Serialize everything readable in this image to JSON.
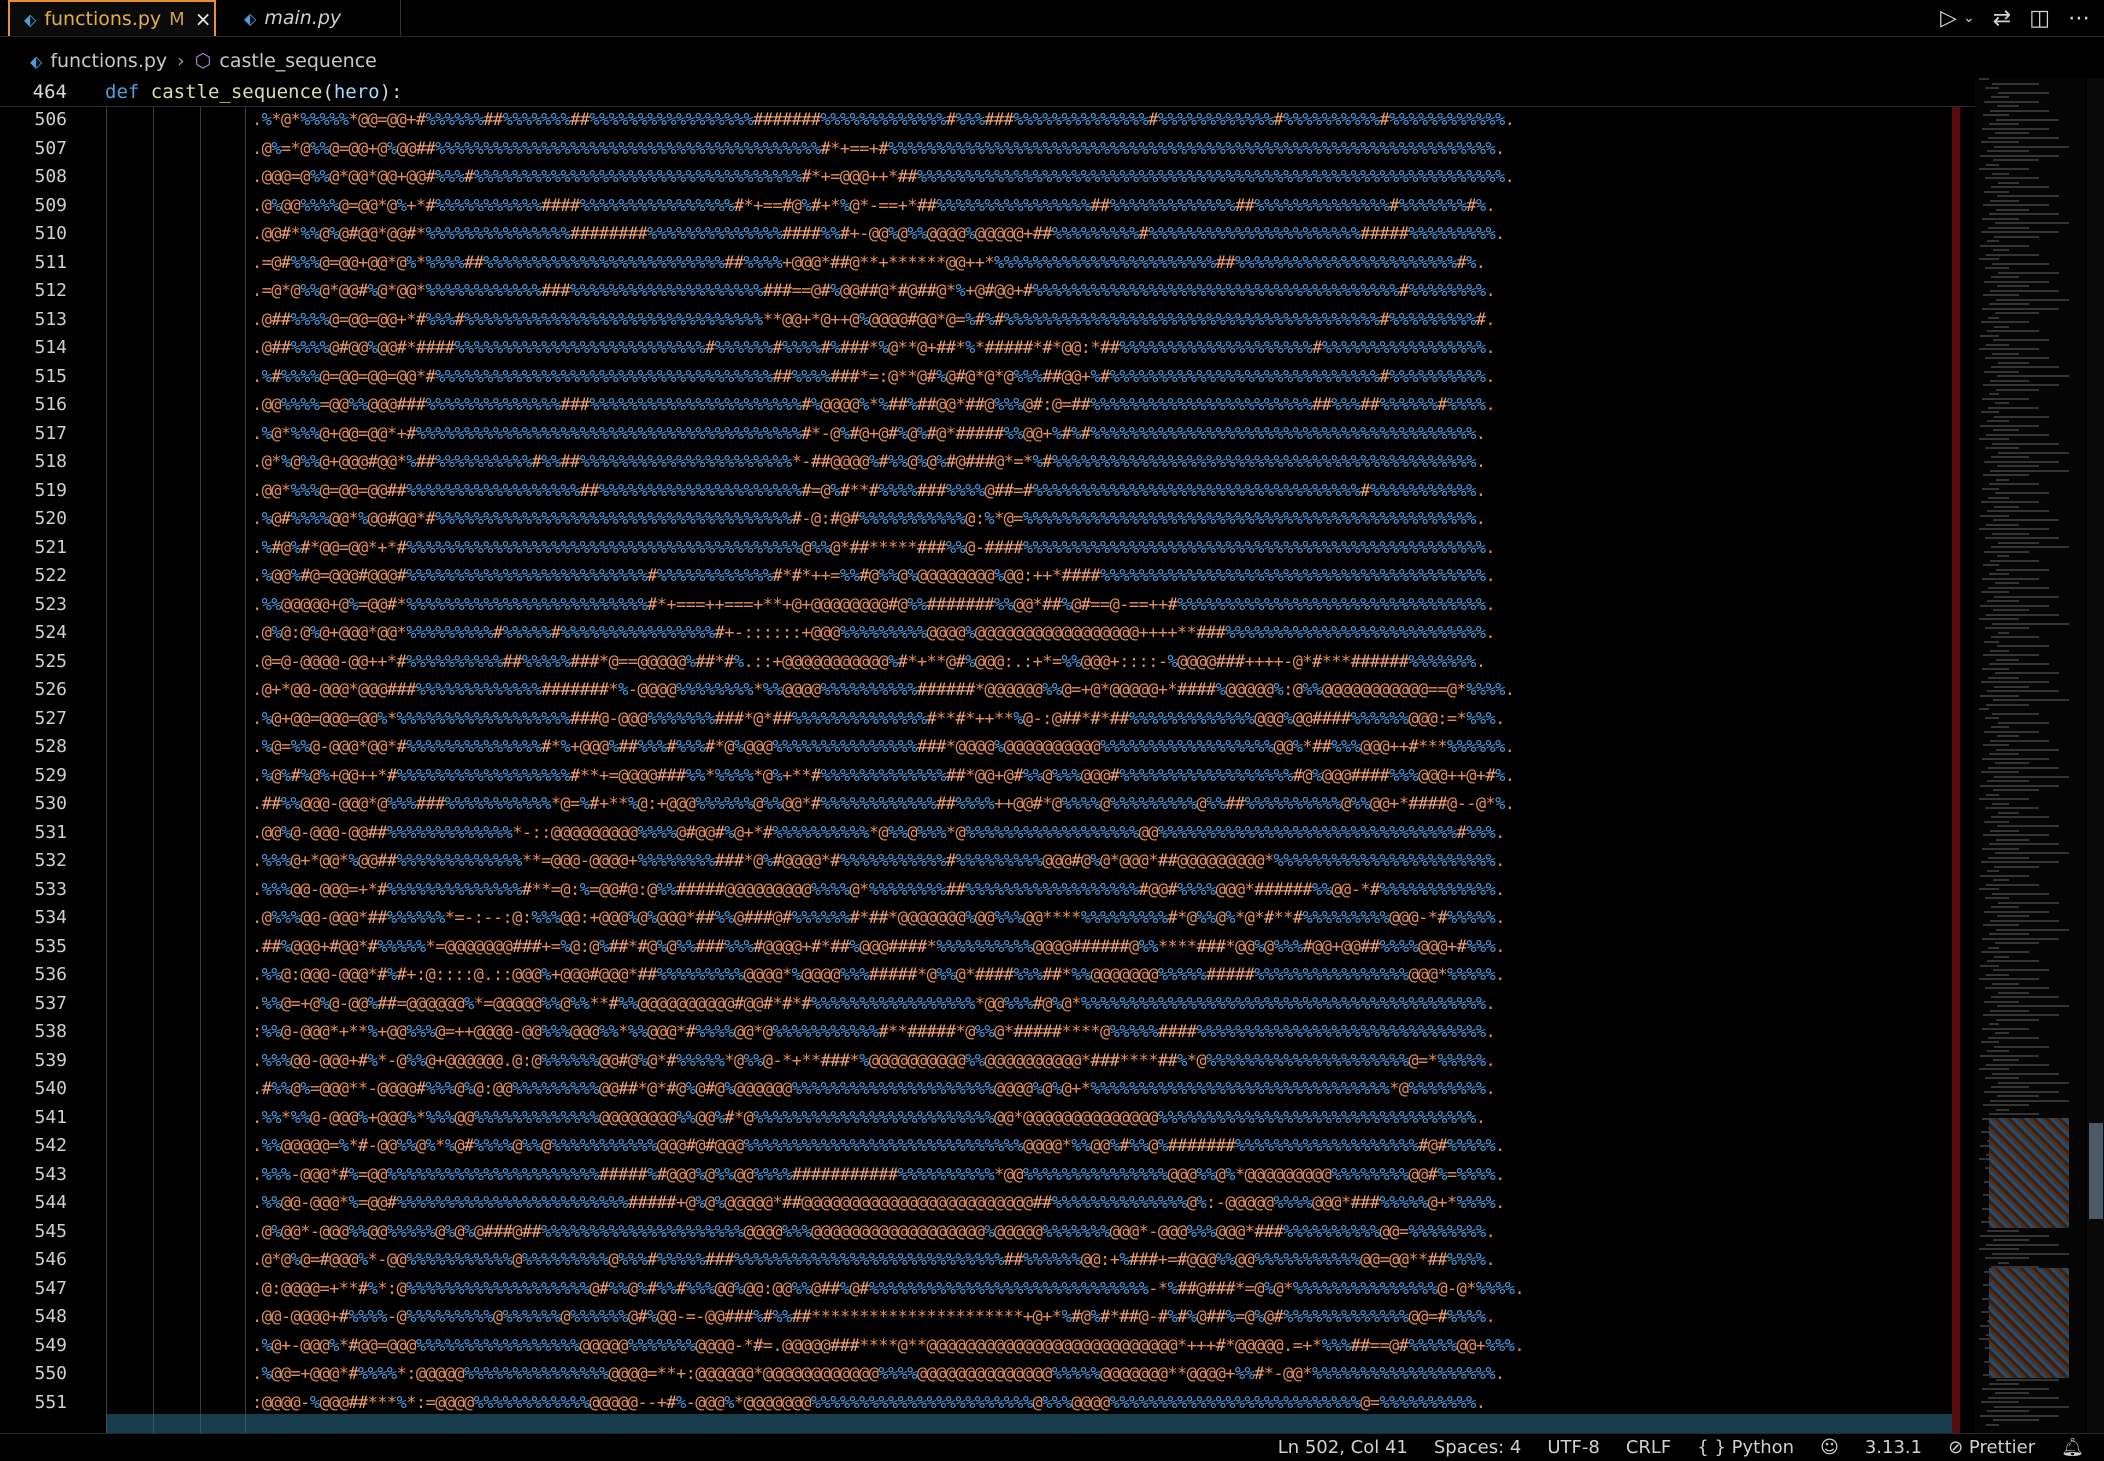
{
  "tabs": [
    {
      "label": "functions.py",
      "modified": "M",
      "close": "×"
    },
    {
      "label": "main.py"
    }
  ],
  "toolbar_icons": [
    "run-icon",
    "dropdown-icon",
    "compare-changes-icon",
    "split-editor-icon",
    "more-actions-icon"
  ],
  "breadcrumb": {
    "file": "functions.py",
    "symbol": "castle_sequence"
  },
  "sticky_line": {
    "number": "464",
    "keyword": "def",
    "function": "castle_sequence",
    "param": "hero",
    "open": "(",
    "close": "):"
  },
  "editor": {
    "line_numbers": [
      "506",
      "507",
      "508",
      "509",
      "510",
      "511",
      "512",
      "513",
      "514",
      "515",
      "516",
      "517",
      "518",
      "519",
      "520",
      "521",
      "522",
      "523",
      "524",
      "525",
      "526",
      "527",
      "528",
      "529",
      "530",
      "531",
      "532",
      "533",
      "534",
      "535",
      "536",
      "537",
      "538",
      "539",
      "540",
      "541",
      "542",
      "543",
      "544",
      "545",
      "546",
      "547",
      "548",
      "549",
      "550",
      "551"
    ],
    "content_note_hidden": "",
    "lines": [
      ".%*@*%%%%%*@@=@@+#%%%%%%##%%%%%%%##%%%%%%%%%%%%%%%%%#######%%%%%%%%%%%%%#%%%###%%%%%%%%%%%%%%#%%%%%%%%%%%%#%%%%%%%%%%#%%%%%%%%%%%%.",
      ".@%=*@%%@=@@+@%@@##%%%%%%%%%%%%%%%%%%%%%%%%%%%%%%%%%%%%%%%%#*+==+#%%%%%%%%%%%%%%%%%%%%%%%%%%%%%%%%%%%%%%%%%%%%%%%%%%%%%%%%%%%%%%%.",
      ".@@@=@%%@*@@*@@+@@#%%%#%%%%%%%%%%%%%%%%%%%%%%%%%%%%%%%%%%#*+=@@@++*##%%%%%%%%%%%%%%%%%%%%%%%%%%%%%%%%%%%%%%%%%%%%%%%%%%%%%%%%%%%%%.",
      ".@%@@%%%%@=@@*@%+*#%%%%%%%%%%%####%%%%%%%%%%%%%%%%#*+==#@%#+*%@*-==+*##%%%%%%%%%%%%%%%%##%%%%%%%%%%%%%##%%%%%%%%%%%%%%#%%%%%%%#%.",
      ".@@#*%%@%@#@@*@@#*%%%%%%%%%%%%%%%########%%%%%%%%%%%%%%####%%#+-@@%@%%@@@@%@@@@@+##%%%%%%%%%#%%%%%%%%%%%%%%%%%%%%%%#####%%%%%%%%%.",
      ".=@#%%%@=@@+@@*@%*%%%%##%%%%%%%%%%%%%%%%%%%%%%%%%##%%%%+@@@*##@**+******@@++*%%%%%%%%%%%%%%%%%%%%%%%##%%%%%%%%%%%%%%%%%%%%%%%#%.",
      ".=@*@%%@*@@#%@*@@*%%%%%%%%%%%%###%%%%%%%%%%%%%%%%%%%%###==@#%@@##@*#@##@*%+@#@@+#%%%%%%%%%%%%%%%%%%%%%%%%%%%%%%%%%%%%%%#%%%%%%%%.",
      ".@##%%%%@=@@=@@+*#%%%#%%%%%%%%%%%%%%%%%%%%%%%%%%%%%%%**@@+*@++@%@@@@#@@*@=%#%#%%%%%%%%%%%%%%%%%%%%%%%%%%%%%%%%%%%%%%%#%%%%%%%%%#.",
      ".@##%%%%@#@@%@@#*####%%%%%%%%%%%%%%%%%%%%%%%%%%#%%%%%%#%%%%#%###*%@**@+##*%*#####*#*@@:*##%%%%%%%%%%%%%%%%%%%%#%%%%%%%%%%%%%%%%%.",
      ".%#%%%%@=@@=@@=@@*#%%%%%%%%%%%%%%%%%%%%%%%%%%%%%%%%%%%##%%%%###*=:@**@#%@#@*@*@%%%##@@+%#%%%%%%%%%%%%%%%%%%%%%%%%%%%%#%%%%%%%%%%.",
      ".@@%%%%=@@%%@@@###%%%%%%%%%%%%%%###%%%%%%%%%%%%%%%%%%%%%%#%@@@@%*%##%##@@*##@%%%@#:@=##%%%%%%%%%%%%%%%%%%%%%%%##%%%##%%%%%%#%%%%.",
      ".%@*%%%@+@@=@@*+#%%%%%%%%%%%%%%%%%%%%%%%%%%%%%%%%%%%%%%%%#*-@%#@+@#%@%#@*#####%%@@+%#%#%%%%%%%%%%%%%%%%%%%%%%%%%%%%%%%%%%%%%%%%.",
      ".@*%@%%@+@@@#@@*%##%%%%%%%%%%#%%##%%%%%%%%%%%%%%%%%%%%%%*-##@@@@%#%%@%@%#@###@*=*%#%%%%%%%%%%%%%%%%%%%%%%%%%%%%%%%%%%%%%%%%%%%%.",
      ".@@*%%%@=@@=@@##%%%%%%%%%%%%%%%%%%##%%%%%%%%%%%%%%%%%%%%%#=@%#**#%%%%###%%%%@##=#%%%%%%%%%%%%%%%%%%%%%%%%%%%%%%%%%%#%%%%%%%%%%%.",
      ".%@#%%%%@@*%@@#@@*#%%%%%%%%%%%%%%%%%%%%%%%%%%%%%%%%%%%%%#-@:#@#%%%%%%%%%%%@:%*@=%%%%%%%%%%%%%%%%%%%%%%%%%%%%%%%%%%%%%%%%%%%%%%%.",
      ".%#@%#*@@=@@*+*#%%%%%%%%%%%%%%%%%%%%%%%%%%%%%%%%%%%%%%%%%@%%@*##*****###%%@-####%%%%%%%%%%%%%%%%%%%%%%%%%%%%%%%%%%%%%%%%%%%%%%%%.",
      ".%@@%#@=@@@#@@@#%%%%%%%%%%%%%%%%%%%%%%%%%#%%%%%%%%%%%%#*#*++=%%#@%%@%@@@@@@@@%@@:++*####%%%%%%%%%%%%%%%%%%%%%%%%%%%%%%%%%%%%%%%%.",
      ".%%@@@@@+@%=@@#*%%%%%%%%%%%%%%%%%%%%%%%%%#*+===++===+**+@+@@@@@@@@#@%%#######%%@@*##%@#==@-==++#%%%%%%%%%%%%%%%%%%%%%%%%%%%%%%%%.",
      ".@%@:@%@+@@@*@@*%%%%%%%%%#%%%%%#%%%%%%%%%%%%%%%%#+-::::::+@@@%%%%%%%%%@@@@%@@@@@@@@@@@@@@@@@++++**###%%%%%%%%%%%%%%%%%%%%%%%%%%%.",
      ".@=@-@@@@-@@++*#%%%%%%%%%%##%%%%%###*@==@@@@@%##*#%.::+@@@@@@@@@@@%#*+**@#%@@@:.:+*=%%@@@+::::-%@@@@###++++-@*#***######%%%%%%%.",
      ".@+*@@-@@@*@@@###%%%%%%%%%%%%%#######*%-@@@@%%%%%%%%*%%@@@@%%%%%%%%%%######*@@@@@@%%@=+@*@@@@@+*####%@@@@@%:@%%@@@@@@@@@@@==@*%%%%.",
      ".%@+@@=@@@=@@%*%%%%%%%%%%%%%%%%%%###@-@@@%%%%%%%###*@*##%%%%%%%%%%%%%%#**#*++**%@-:@##*#*##%%%%%%%%%%%%%@@@%@@####%%%%%%@@@:=*%%%.",
      ".%@=%%@-@@@*@@*#%%%%%%%%%%%%%%#*%+@@@%##%%%#%%%#*@%@@@%%%%%%%%%%%%%%%###*@@@@%@@@@@@@@@@%%%%%%%%%%%%%%%%%%@@%*##%%%@@@++#***%%%%%%.",
      ".%@%#%@%+@@++*#%%%%%%%%%%%%%%%%%%#**+=@@@@###%%*%%%%*@%+**#%%%%%%%%%%%%%##*@@+@#%%@%%%@@@#%%%%%%%%%%%%%%%%%%#@%@@@####%%%@@@++@+#%.",
      ".##%%@@@-@@@*@%%%###%%%%%%%%%%%*@=%#+**%@:+@@@%%%%%%@%%@@*#%%%%%%%%%%%%##%%%%++@@#*@%%%%@%%%%%%%%%@%%##%%%%%%%%%%@%%@@+*####@--@*%.",
      ".@@%@-@@@-@@##%%%%%%%%%%%%%*-::@@@@@@@@@%%%%@#@@#%@+*#%%%%%%%%%%*@%%@%%%*@%%%%%%%%%%%%%%%%%%@@%%%%%%%%%%%%%%%%%%%%%%%%%%%%%%%#%%%.",
      ".%%%@+*@@*%@@##%%%%%%%%%%%%%**=@@@-@@@@+%%%%%%%%###*@%#@@@@*#%%%%%%%%%%%#%%%%%%%%%@@@#@%@*@@@*##@@@@@@@@@*%%%%%%%%%%%%%%%%%%%%%%%.",
      ".%%%@@-@@@=+*#%%%%%%%%%%%%%%#**=@:%=@@#@:@%%#####@@@@@@@@@%%%%@*%%%%%%%%##%%%%%%%%%%%%%%%%%%#@@#%%%%@@@*######%%@@-*#%%%%%%%%%%%%.",
      ".@%%%@@-@@@*##%%%%%%*=-:--:@:%%%@@:+@@@%@%@@@*##%%@###@#%%%%%%#*##*@@@@@@@%@@%%%@@****%%%%%%%%%#*@%%@%*@*#**#%%%%%%%%%@@@-*#%%%%%.",
      ".##%@@@+#@@*#%%%%%*=@@@@@@@###+=%@:@%##*#@%@%%###%%%#@@@@+#*##%@@@####*%%%%%%%%%%@@@@######@%%****###*@@%@%%%#@@+@@##%%%%@@@+#%%%.",
      ".%%@:@@@-@@@*#%#+:@::::@.::@@@%+@@@#@@@*##%%%%%%%%%@@@@*%@@@@%%%#####*@%%@*####%%%##*%%@@@@@@@%%%%%#####%%%%%%%%%%%%%%%%@@@*%%%%%.",
      ".%%@=+@%@-@@%##=@@@@@@%*=@@@@@%%@%%**#%%@@@@@@@@@@#@@#*#*#%%%%%%%%%%%%%%%%%*@@%%%#@%@*%%%%%%%%%%%%%%%%%%%%%%%%%%%%%%%%%%%%%%%%%%.",
      ":%%@-@@@*+**%+@@%%%@=++@@@@-@@%%%@@@%%*%%@@@*#%%%%@@*@%%%%%%%%%%%#**#####*@%%@*#####****@%%%%%####%%%%%%%%%%%%%%%%%%%%%%%%%%%%%%.",
      ".%%%@@-@@@+#%*-@%%@+@@@@@@.@:@%%%%%%@@#@%@*#%%%%%*@%%@-*+**###*%@@@@@@@@@@%%@@@@@@@@@@*###****##%*@%%%%%%%%%%%%%%%%%%%%%@=*%%%%%.",
      ".#%%@%=@@@**-@@@@#%%%@%@:@@%%%%%%%%%@@##*@*#@%@#@%@@@@@@%%%%%%%%%%%%%%%%%%%%%@@@@%@%@+*%%%%%%%%%%%%%%%%%%%%%%%%%%%%%%%*@%%%%%%%%.",
      ".%%*%%@-@@@%+@@@%*%%%@@%%%%%%%%%%%%%@@@@@@@@%%@@%#*@%%%%%%%%%%%%%%%%%%%%%%%%%@@*@@@@@@@@@@@@@@%%%%%%%%%%%%%%%%%%%%%%%%%%%%%%%%%.",
      ".%%@@@@@=%*#-@@%%@%*%@#%%%%@%%@%%%%%%%%%%%@@@#@#@@@%%%%%%%%%%%%%%%%%%%%%%%%%%%%%@@@@*%%@@%#%%@%#######%%%%%%%%%%%%%%%%%%%#@#%%%%%.",
      ".%%%-@@@*#%=@@%%%%%%%%%%%%%%%%%%%%%%#####%#@@@%@%%@@%%%%###########%%%%%%%%%%*@@%%%%%%%%%%%%%%%@@@%%@%*@@@@@@@@@%%%%%%%%@@#%=%%%%.",
      ".%%@@-@@@*%=@@#%%%%%%%%%%%%%%%%%%%%%%%%#####+@%@%@@@@@*##@@@@@@@@@@@@@@@@@@@@@@@@##%%%%%%%%%%%%%%@%:-@@@@@%%%%@@@*###%%%%%@+*%%%%.",
      ".@%@@*-@@@%%@@%%%%%@%@%@###@##%%%%%%%%%%%%%%%%%%%%%@@@@%%%@@@@@@@@@@@@@@@@@@%@@@@@%%%%%%%@@@*-@@@%%%@@@*###%%%%%%%%%%@@=%%%%%%%%.",
      ".@*@%@=#@@@%*-@@%%%%%%%%%%%@%%%%%%%%%@%%%#%%%%%###%%%%%%%%%%%%%%%%%%%%%%%%%%%%##%%%%%%@@:+%###+=#@@@%%@@%%%%%%%%%%%@@=@@**##%%%%.",
      ".@:@@@@=+**#%*:@%%%%%%%%%%%%%%%%%%%@#%%@%#%%#%%%@@%@@:@@%%@##%@#%%%%%%%%%%%%%%%%%%%%%%%%%%%%%-*%##@###*=@%@*%%%%%%%%%%%%%%%@-@*%%%%.",
      ".@@-@@@@+#%%%%-@%%%%%%%%%@%%%%%%@%%%%%%@#%@@-=-@@###%#%%##**********************+@+*%#@%#*##@-#%#%@##%=@%@#%%%%%%%%%%%%%@@=#%%%%.",
      ".%@+-@@@%*#@@=@@@%%%%%%%%%%%%%%%%%@@@@@%%%%%%%@@@@-*#=.@@@@@###****@**@@@@@@@@@@@@@@@@@@@@@@@@@@*+++#*@@@@@.=+*%%%##==@#%%%%%@@+%%%.",
      ".%@@=+@@@*#%%%%*:@@@@@%%%%%%%%%%%%%%%@@@@=**+:@@@@@@*@@@@@@@@@@@@%%%%@@@@@@@@@@@@@@%%%%%@@@@@@@**@@@@+%%#*-@@*%%%%%%%%%%%%%%%%%%%.",
      ":@@@@-%@@@##***%*:=@@@@%%%%%%%%%%%%@@@@@--+#%-@@@%*@@@@@@@%%%%%%%%%%%%%%%%%%%%%%%@%%%@@@@%%%%%%%%%%%%%%%%%%%%%%%%%%@=%%%%%%%%%%."
    ]
  },
  "status_bar": {
    "position": "Ln 502, Col 41",
    "spaces": "Spaces: 4",
    "encoding": "UTF-8",
    "eol": "CRLF",
    "language": "Python",
    "language_icon": "{ }",
    "version": "3.13.1",
    "formatter": "Prettier"
  },
  "colors": {
    "orange": "#e38e57",
    "blue": "#4b9ae0",
    "tab_border": "#e8912d"
  }
}
